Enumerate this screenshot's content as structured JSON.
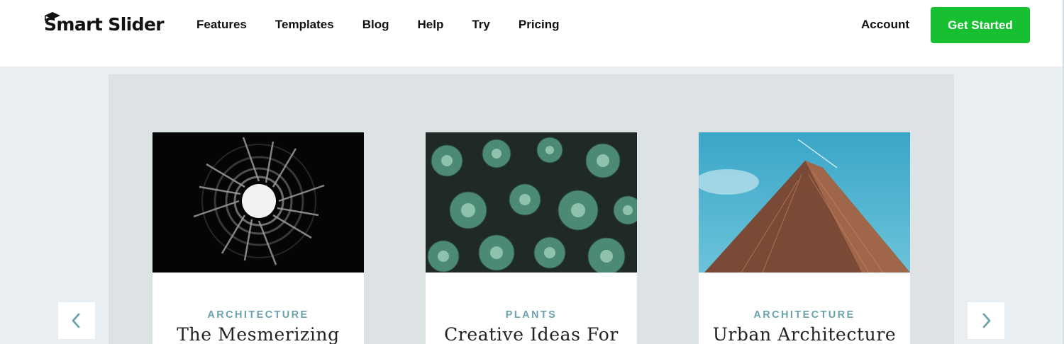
{
  "header": {
    "logo_text": "Smart Slider",
    "nav": [
      "Features",
      "Templates",
      "Blog",
      "Help",
      "Try",
      "Pricing"
    ],
    "account_label": "Account",
    "cta_label": "Get Started"
  },
  "colors": {
    "cta": "#16c030",
    "category": "#6aa2ad",
    "slider_bg": "#dde2e5",
    "page_bg": "#e8eef2"
  },
  "slides": [
    {
      "category": "ARCHITECTURE",
      "title": "The Mesmerizing",
      "image": "architecture-tunnel-image"
    },
    {
      "category": "PLANTS",
      "title": "Creative Ideas For",
      "image": "succulents-image"
    },
    {
      "category": "ARCHITECTURE",
      "title": "Urban Architecture",
      "image": "skyscraper-image"
    }
  ],
  "controls": {
    "prev_icon": "chevron-left-icon",
    "next_icon": "chevron-right-icon"
  }
}
